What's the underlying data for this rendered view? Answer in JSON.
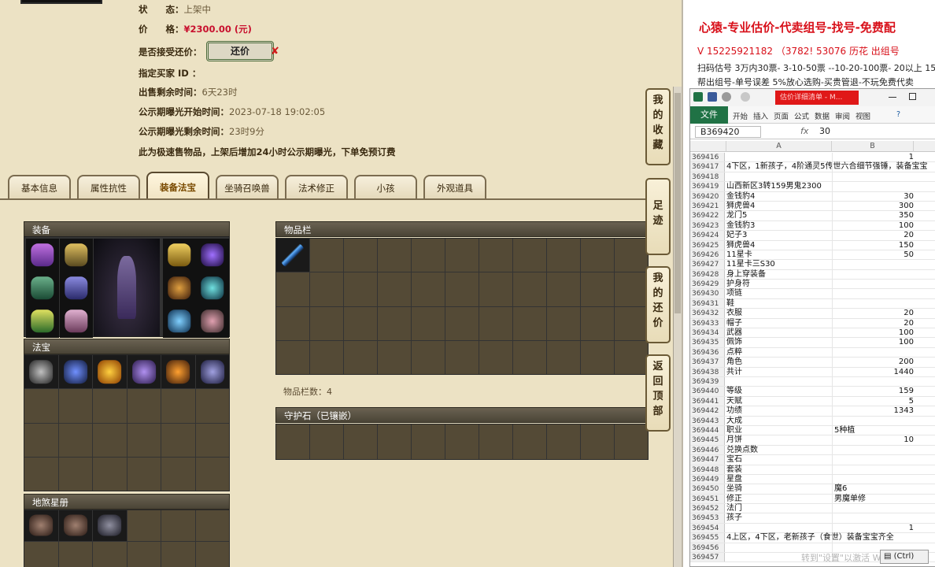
{
  "listing": {
    "status_label": "状　　态：",
    "status_value": "上架中",
    "price_label": "价　　格：",
    "price_value": "¥2300.00 (元)",
    "haggle_label": "是否接受还价：",
    "haggle_button": "还价",
    "buyer_label": "指定买家 ID ：",
    "buyer_value": "",
    "remaining_label": "出售剩余时间：",
    "remaining_value": "6天23时",
    "expose_start_label": "公示期曝光开始时间：",
    "expose_start_value": "2023-07-18 19:02:05",
    "expose_left_label": "公示期曝光剩余时间：",
    "expose_left_value": "23时9分",
    "notice": "此为极速售物品，上架后增加24小时公示期曝光，下单免预订费"
  },
  "tabs": [
    "基本信息",
    "属性抗性",
    "装备法宝",
    "坐骑召唤兽",
    "法术修正",
    "小孩",
    "外观道具"
  ],
  "active_tab": "装备法宝",
  "sections": {
    "equipment": "装备",
    "inventory": "物品栏",
    "treasure": "法宝",
    "guard_stone": "守护石（已镶嵌）",
    "constellation": "地煞星册",
    "inventory_count": "物品栏数：4"
  },
  "side_nav": {
    "favorites": "我的收藏",
    "footprints": "足迹",
    "my_offers": "我的还价",
    "back_top": "返回顶部"
  },
  "ad": {
    "line1": "心猿-专业估价-代卖组号-找号-免费配",
    "line2": "V 15225921182  （3782! 53076 历花 出组号",
    "line3": "扫码估号 3万内30票- 3-10-50票  --10-20-100票- 20以上 15",
    "line4": "帮出组号-单号误差 5%放心选购-买贵管退-不玩免费代卖"
  },
  "excel": {
    "window_tab": "估价详细清单 - M...",
    "file_tab": "文件",
    "ribbon": [
      "开始",
      "插入",
      "页面",
      "公式",
      "数据",
      "审阅",
      "视图"
    ],
    "name_box": "B369420",
    "fx": "fx",
    "formula_value": "30",
    "columns": [
      "A",
      "B"
    ],
    "paste_badge": "(Ctrl)",
    "watermark": "转到\"设置\"以激活 Windows。",
    "rows": [
      {
        "n": "369416",
        "a": "",
        "b": "1"
      },
      {
        "n": "369417",
        "a": "4下区，1新孩子，4阶通灵5传世六合细节强锤，装备宝宝",
        "b": ""
      },
      {
        "n": "369418",
        "a": "",
        "b": ""
      },
      {
        "n": "369419",
        "a": "山西新区3转159男鬼2300",
        "b": ""
      },
      {
        "n": "369420",
        "a": "金钱豹4",
        "b": "30"
      },
      {
        "n": "369421",
        "a": "狮虎兽4",
        "b": "300"
      },
      {
        "n": "369422",
        "a": "龙门5",
        "b": "350"
      },
      {
        "n": "369423",
        "a": "金钱豹3",
        "b": "100"
      },
      {
        "n": "369424",
        "a": "妃子3",
        "b": "20"
      },
      {
        "n": "369425",
        "a": "狮虎兽4",
        "b": "150"
      },
      {
        "n": "369426",
        "a": "11星卡",
        "b": "50"
      },
      {
        "n": "369427",
        "a": "11星卡三S30",
        "b": ""
      },
      {
        "n": "369428",
        "a": "身上穿装备",
        "b": ""
      },
      {
        "n": "369429",
        "a": "护身符",
        "b": ""
      },
      {
        "n": "369430",
        "a": "项链",
        "b": ""
      },
      {
        "n": "369431",
        "a": "鞋",
        "b": ""
      },
      {
        "n": "369432",
        "a": "衣服",
        "b": "20"
      },
      {
        "n": "369433",
        "a": "帽子",
        "b": "20"
      },
      {
        "n": "369434",
        "a": "武器",
        "b": "100"
      },
      {
        "n": "369435",
        "a": "佩饰",
        "b": "100"
      },
      {
        "n": "369436",
        "a": "点粹",
        "b": ""
      },
      {
        "n": "369437",
        "a": "角色",
        "b": "200"
      },
      {
        "n": "369438",
        "a": "共计",
        "b": "1440"
      },
      {
        "n": "369439",
        "a": "",
        "b": ""
      },
      {
        "n": "369440",
        "a": "等级",
        "b": "159"
      },
      {
        "n": "369441",
        "a": "天赋",
        "b": "5"
      },
      {
        "n": "369442",
        "a": "功绩",
        "b": "1343"
      },
      {
        "n": "369443",
        "a": "大成",
        "b": ""
      },
      {
        "n": "369444",
        "a": "职业",
        "b": "5种植",
        "btxt": true
      },
      {
        "n": "369445",
        "a": "月饼",
        "b": "10"
      },
      {
        "n": "369446",
        "a": "兑换点数",
        "b": ""
      },
      {
        "n": "369447",
        "a": "宝石",
        "b": ""
      },
      {
        "n": "369448",
        "a": "套装",
        "b": ""
      },
      {
        "n": "369449",
        "a": "星盘",
        "b": ""
      },
      {
        "n": "369450",
        "a": "坐骑",
        "b": "魔6",
        "btxt": true
      },
      {
        "n": "369451",
        "a": "修正",
        "b": "男魔单修",
        "btxt": true
      },
      {
        "n": "369452",
        "a": "法门",
        "b": ""
      },
      {
        "n": "369453",
        "a": "孩子",
        "b": ""
      },
      {
        "n": "369454",
        "a": "",
        "b": "1"
      },
      {
        "n": "369455",
        "a": "4上区，4下区，老新孩子（食世）装备宝宝齐全",
        "b": ""
      },
      {
        "n": "369456",
        "a": "",
        "b": ""
      },
      {
        "n": "369457",
        "a": "",
        "b": ""
      }
    ]
  },
  "colors": {
    "accent_red": "#c8102e",
    "excel_green": "#207245",
    "panel_bg": "#ece2c4",
    "slot_bg": "#544a36"
  }
}
